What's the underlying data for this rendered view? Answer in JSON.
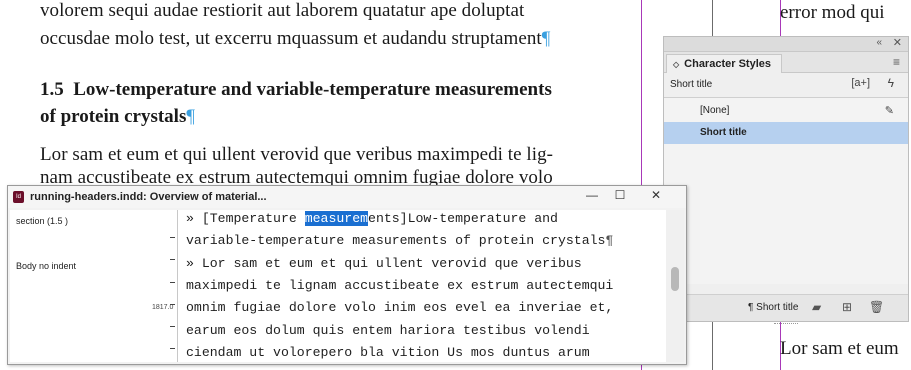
{
  "document": {
    "intro_lines": [
      "volorem sequi audae restiorit aut laborem quatatur ape doluptat",
      "occusdae molo test, ut excerru mquassum et audandu struptament"
    ],
    "heading_number": "1.5",
    "heading_line1": "Low-temperature and variable-temperature measurements",
    "heading_line2": "of protein crystals",
    "pilcrow": "¶",
    "body_lines": [
      "Lor sam et eum et qui ullent verovid que veribus maximpedi te lig-",
      "nam accustibeate ex estrum autectemqui omnim fugiae dolore volo"
    ],
    "right_col_lines": [
      "error mod qui",
      "Lor sam et eum"
    ]
  },
  "character_styles": {
    "tab_label": "Character Styles",
    "current_style": "Short title",
    "new_style_glyph": "[a+]",
    "items": [
      {
        "label": "[None]",
        "selected": false
      },
      {
        "label": "Short title",
        "selected": true
      }
    ],
    "footer_label": "¶ Short title"
  },
  "story_editor": {
    "title": "running-headers.indd: Overview of material...",
    "info_rows": [
      "section (1.5 )",
      "Body no indent"
    ],
    "depth_label": "1817.0",
    "lines": [
      {
        "pre": "» [Temperature ",
        "hl": "measurem",
        "post": "ents]Low-temperature and"
      },
      {
        "pre": "variable-temperature measurements of protein crystals",
        "hl": "",
        "post": "¶"
      },
      {
        "pre": "» Lor sam et eum et qui ullent verovid que veribus",
        "hl": "",
        "post": ""
      },
      {
        "pre": "maximpedi te lignam accustibeate ex estrum autectemqui",
        "hl": "",
        "post": ""
      },
      {
        "pre": "omnim fugiae dolore volo inim eos evel ea inveriae et,",
        "hl": "",
        "post": ""
      },
      {
        "pre": "earum eos dolum quis entem hariora testibus volendi",
        "hl": "",
        "post": ""
      },
      {
        "pre": "ciendam ut volorepero bla vition Us mos duntus arum",
        "hl": "",
        "post": ""
      }
    ]
  },
  "colors": {
    "selection_blue": "#1a6fd1",
    "list_selection": "#b6d0ef",
    "guide_purple": "#a838b8",
    "pilcrow_blue": "#3aa0e0"
  },
  "icons": {
    "collapse": "double-chevron-icon",
    "close": "close-icon",
    "panel_menu": "hamburger-menu-icon",
    "lightning": "lightning-icon",
    "pen_override": "pen-icon",
    "folder": "folder-icon",
    "new_style": "new-style-icon",
    "trash": "trash-icon",
    "app": "indesign-app-icon"
  }
}
